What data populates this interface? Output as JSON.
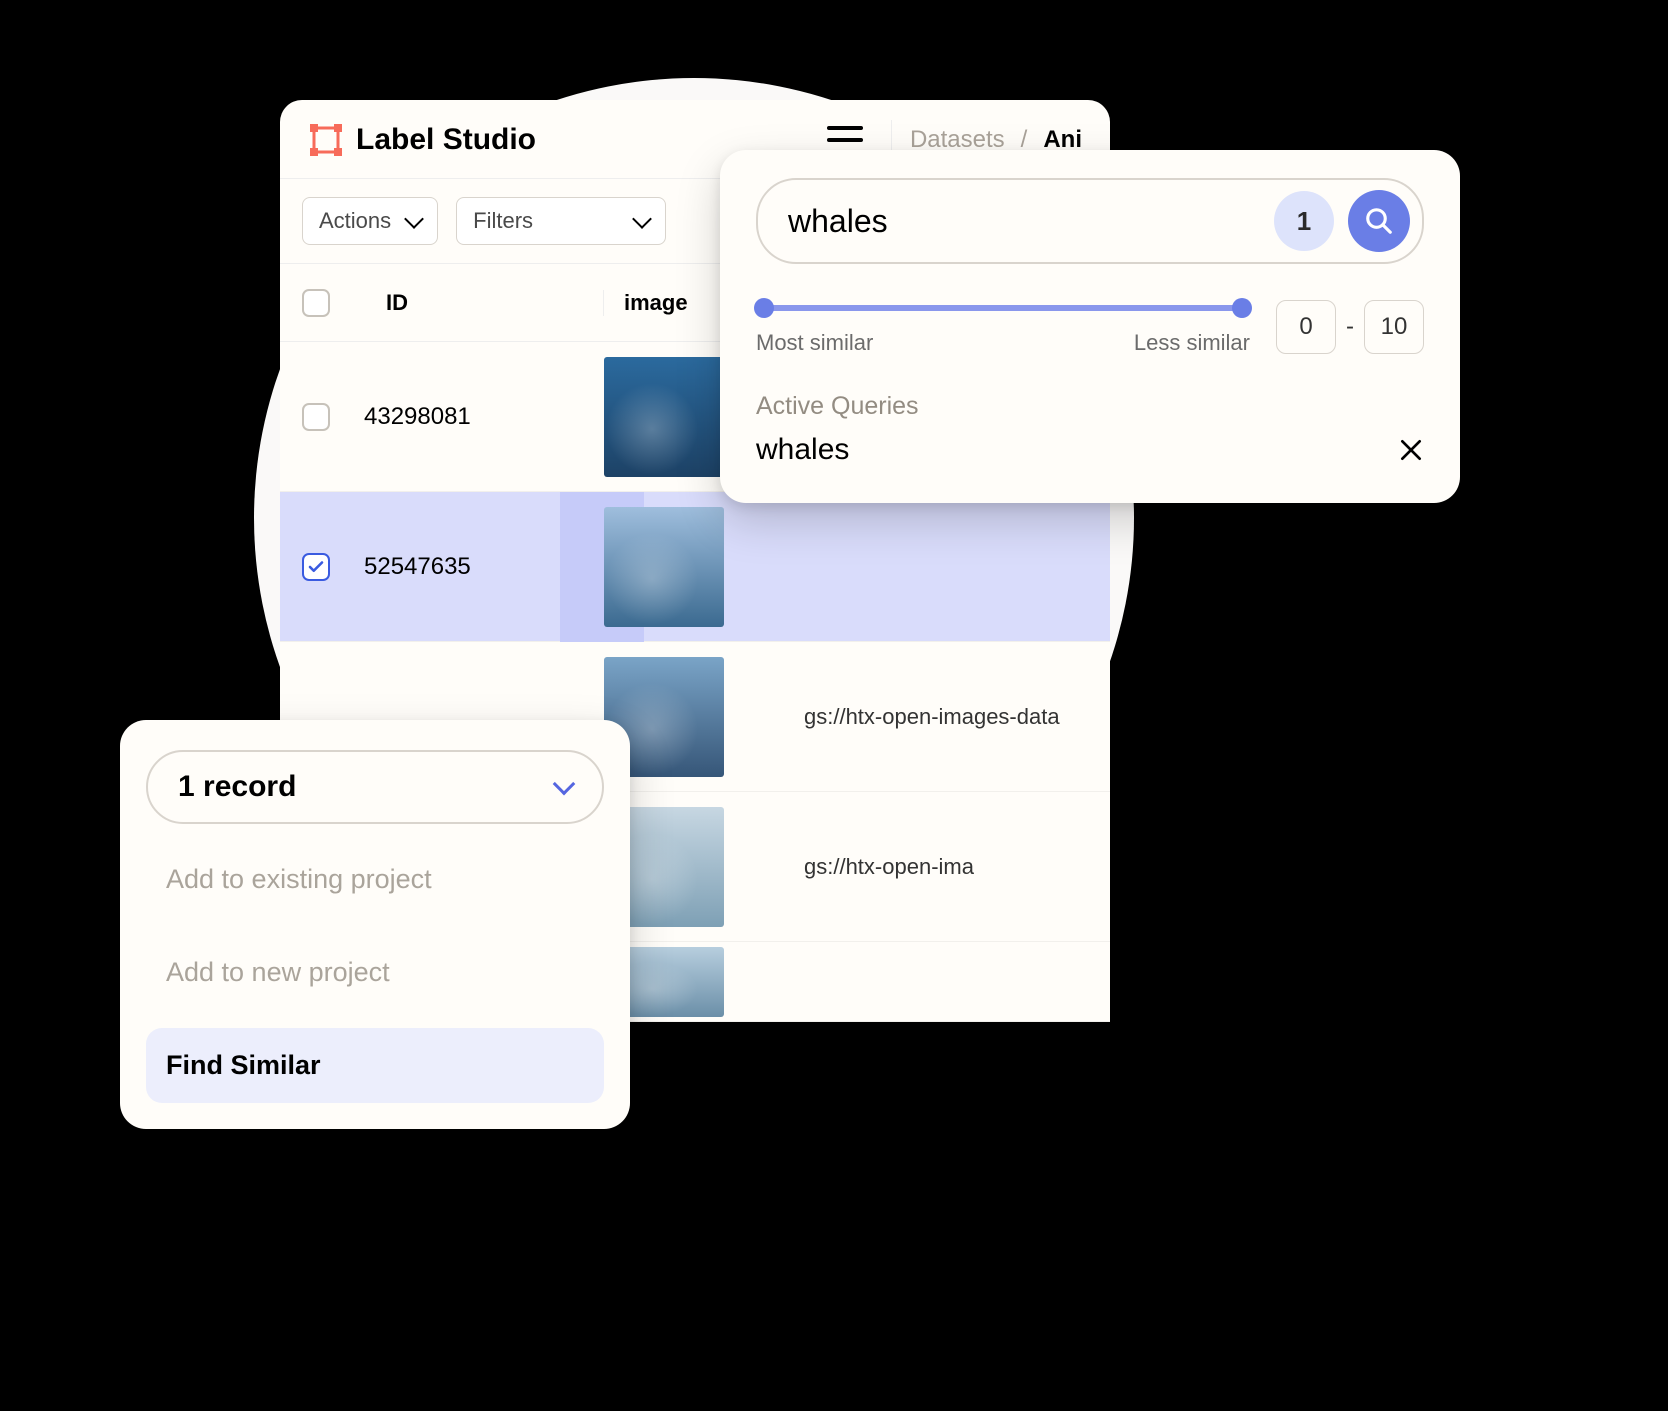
{
  "app": {
    "title": "Label Studio"
  },
  "breadcrumb": {
    "root": "Datasets",
    "sep": "/",
    "current": "Ani"
  },
  "toolbar": {
    "actions": "Actions",
    "filters": "Filters"
  },
  "table": {
    "headers": {
      "id": "ID",
      "image": "image"
    },
    "rows": [
      {
        "id": "43298081",
        "checked": false,
        "path": ""
      },
      {
        "id": "52547635",
        "checked": true,
        "path": ""
      },
      {
        "id": "",
        "checked": false,
        "path": "gs://htx-open-images-data"
      },
      {
        "id": "",
        "checked": false,
        "path": "gs://htx-open-ima"
      },
      {
        "id": "",
        "checked": false,
        "path": ""
      }
    ]
  },
  "search": {
    "query": "whales",
    "count": "1",
    "slider": {
      "left_label": "Most similar",
      "right_label": "Less similar"
    },
    "range": {
      "min": "0",
      "sep": "-",
      "max": "10"
    },
    "active_queries_title": "Active Queries",
    "active_query": "whales"
  },
  "menu": {
    "records": "1 record",
    "items": [
      {
        "label": "Add to existing project",
        "active": false
      },
      {
        "label": "Add to new project",
        "active": false
      },
      {
        "label": "Find Similar",
        "active": true
      }
    ]
  }
}
